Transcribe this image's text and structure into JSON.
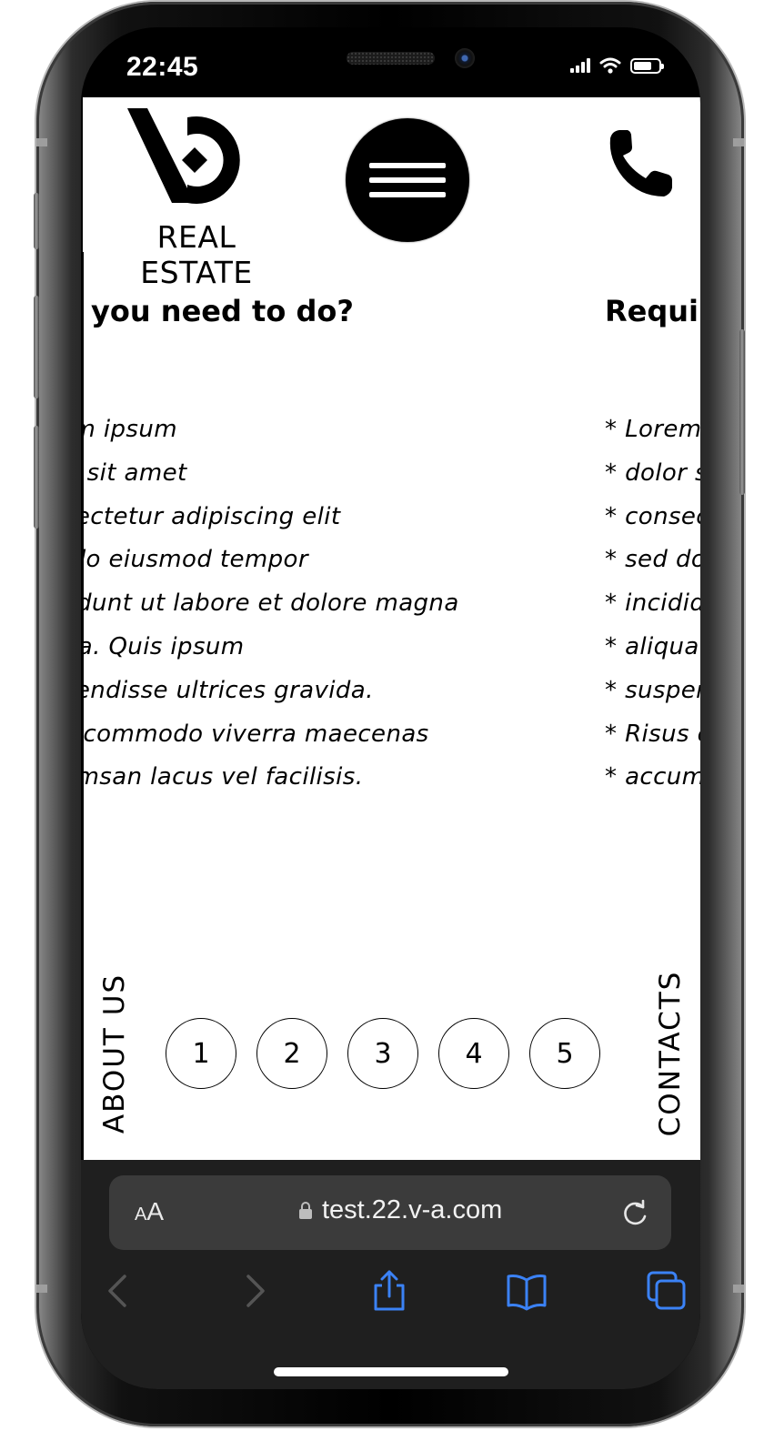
{
  "status_bar": {
    "time": "22:45"
  },
  "header": {
    "logo_text": "REAL ESTATE"
  },
  "columns": {
    "left": {
      "heading": "at you need to do?",
      "items": [
        "rem ipsum",
        "lor sit amet",
        "nsectetur adipiscing elit",
        "d do eiusmod tempor",
        "ididunt ut labore et dolore magna",
        "qua. Quis ipsum",
        "spendisse ultrices gravida.",
        "us commodo viverra maecenas",
        "cumsan lacus vel facilisis."
      ]
    },
    "right": {
      "heading": "Requir",
      "items": [
        "* Lorem",
        "* dolor s",
        "* consec",
        "* sed do",
        "* incidid",
        "* aliqua",
        "* susper",
        "* Risus c",
        "* accum"
      ]
    }
  },
  "footer_nav": {
    "about": "ABOUT US",
    "contacts": "CONTACTS",
    "pages": [
      "1",
      "2",
      "3",
      "4",
      "5"
    ]
  },
  "browser": {
    "aa_small": "A",
    "aa_large": "A",
    "url": "test.22.v-a.com",
    "accent_color": "#3b82f6"
  },
  "icons": {
    "status": [
      "cellular-signal-icon",
      "wifi-icon",
      "battery-icon"
    ],
    "toolbar": [
      "back-icon",
      "forward-icon",
      "share-icon",
      "bookmarks-icon",
      "tabs-icon"
    ]
  }
}
